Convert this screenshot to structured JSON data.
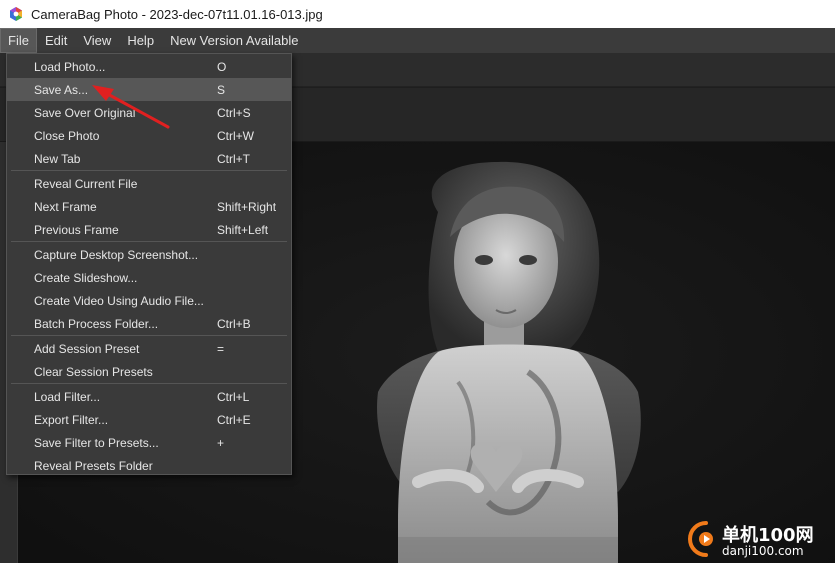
{
  "window": {
    "title": "CameraBag Photo - 2023-dec-07t11.01.16-013.jpg"
  },
  "menubar": {
    "items": [
      {
        "label": "File",
        "active": true
      },
      {
        "label": "Edit"
      },
      {
        "label": "View"
      },
      {
        "label": "Help"
      },
      {
        "label": "New Version Available"
      }
    ]
  },
  "file_menu": {
    "groups": [
      [
        {
          "label": "Load Photo...",
          "shortcut": "O"
        },
        {
          "label": "Save As...",
          "shortcut": "S",
          "highlighted": true
        },
        {
          "label": "Save Over Original",
          "shortcut": "Ctrl+S"
        },
        {
          "label": "Close Photo",
          "shortcut": "Ctrl+W"
        },
        {
          "label": "New Tab",
          "shortcut": "Ctrl+T"
        }
      ],
      [
        {
          "label": "Reveal Current File",
          "shortcut": ""
        },
        {
          "label": "Next Frame",
          "shortcut": "Shift+Right"
        },
        {
          "label": "Previous Frame",
          "shortcut": "Shift+Left"
        }
      ],
      [
        {
          "label": "Capture Desktop Screenshot...",
          "shortcut": ""
        },
        {
          "label": "Create Slideshow...",
          "shortcut": ""
        },
        {
          "label": "Create Video Using Audio File...",
          "shortcut": ""
        },
        {
          "label": "Batch Process Folder...",
          "shortcut": "Ctrl+B"
        }
      ],
      [
        {
          "label": "Add Session Preset",
          "shortcut": "="
        },
        {
          "label": "Clear Session Presets",
          "shortcut": ""
        }
      ],
      [
        {
          "label": "Load Filter...",
          "shortcut": "Ctrl+L"
        },
        {
          "label": "Export Filter...",
          "shortcut": "Ctrl+E"
        },
        {
          "label": "Save Filter to Presets...",
          "shortcut": "+"
        },
        {
          "label": "Reveal Presets Folder",
          "shortcut": ""
        }
      ]
    ]
  },
  "watermark": {
    "text_cn": "单机100网",
    "text_url": "danji100.com"
  },
  "colors": {
    "menu_bg": "#3a3a3a",
    "highlight": "#575757",
    "arrow": "#e02020",
    "canvas_bg": "#141414"
  }
}
